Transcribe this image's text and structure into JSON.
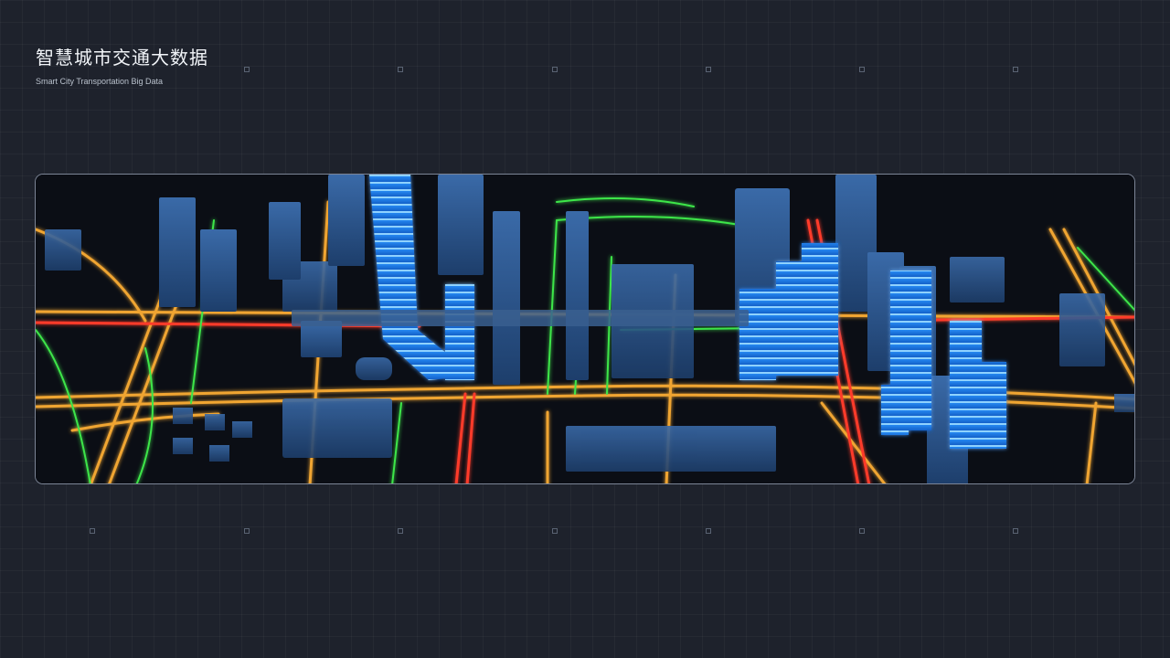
{
  "header": {
    "title": "智慧城市交通大数据",
    "subtitle": "Smart City Transportation Big Data"
  },
  "colors": {
    "background": "#1e222c",
    "road_main": "#f0a530",
    "road_congested": "#ff3b2a",
    "road_clear": "#3ee64a",
    "building": "#2d5f9e",
    "building_highlight": "#1f8bff"
  }
}
